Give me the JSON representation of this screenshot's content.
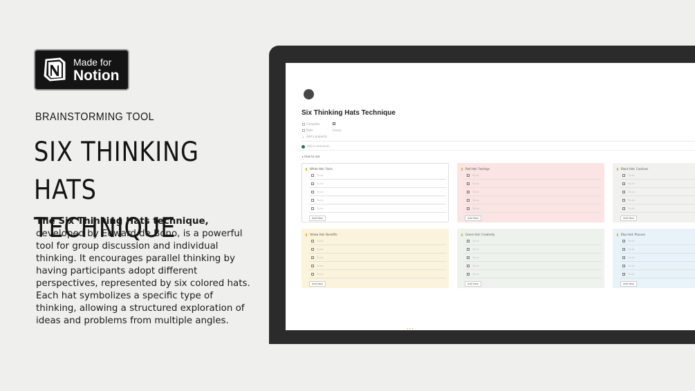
{
  "badge": {
    "line1": "Made for",
    "line2": "Notion",
    "logo_icon": "notion-logo-icon"
  },
  "kicker": "BRAINSTORMING TOOL",
  "title_line1": "SIX THINKING HATS",
  "title_line2": "TECHNIQUE",
  "description": {
    "lead": "The Six Thinking Hats technique,",
    "body": "developed by Edward de Bono, is a powerful tool for group discussion and individual thinking. It encourages parallel thinking by having participants adopt different perspectives, represented by six colored hats. Each hat symbolizes a specific type of thinking, allowing a structured exploration of ideas and problems from multiple angles."
  },
  "notion_page": {
    "title": "Six Thinking Hats Technique",
    "properties": [
      {
        "label": "Complete",
        "value": ""
      },
      {
        "label": "Date",
        "value": "Empty"
      },
      {
        "label": "Add a property",
        "value": ""
      }
    ],
    "comment_placeholder": "Add a comment...",
    "toggle_label": "How to use",
    "cards": [
      {
        "name": "White Hat: Facts",
        "color": "#ffffff",
        "border": "#dddddd"
      },
      {
        "name": "Red Hat: Feelings",
        "color": "#fbe4e4",
        "border": "#fbe4e4"
      },
      {
        "name": "Black Hat: Cautions",
        "color": "#f1f1ef",
        "border": "#f1f1ef"
      },
      {
        "name": "Yellow Hat: Benefits",
        "color": "#fbf3db",
        "border": "#fbf3db"
      },
      {
        "name": "Green Hat: Creativity",
        "color": "#edf3ec",
        "border": "#edf3ec"
      },
      {
        "name": "Blue Hat: Process",
        "color": "#e7f3f8",
        "border": "#e7f3f8"
      }
    ],
    "todo_placeholder": "To-do",
    "add_new_label": "Add New"
  }
}
